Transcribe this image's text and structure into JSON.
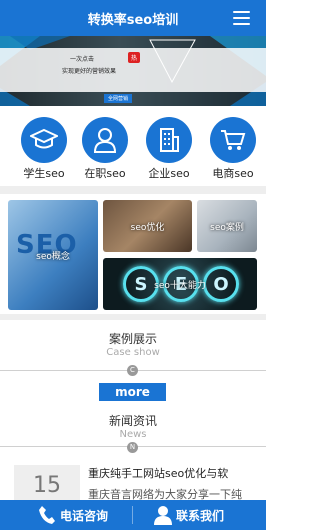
{
  "header": {
    "title": "转换率seo培训",
    "menu_icon": "hamburger-menu-icon"
  },
  "banner": {
    "line1": "一次点击",
    "hot_badge": "热",
    "line2": "实现更好的营销效果",
    "bottom_text": "全网营销"
  },
  "categories": [
    {
      "label": "学生seo",
      "icon": "graduation-cap-icon"
    },
    {
      "label": "在职seo",
      "icon": "user-icon"
    },
    {
      "label": "企业seo",
      "icon": "building-icon"
    },
    {
      "label": "电商seo",
      "icon": "cart-icon"
    }
  ],
  "tiles": [
    {
      "label": "seo概念",
      "art": "SEO"
    },
    {
      "label": "seo优化",
      "art": ""
    },
    {
      "label": "seo案例",
      "art": ""
    },
    {
      "label": "seo十大能力",
      "art": "SEO"
    }
  ],
  "cases": {
    "zh": "案例展示",
    "en": "Case show",
    "marker": "C"
  },
  "more": {
    "label": "more"
  },
  "news": {
    "zh": "新闻资讯",
    "en": "News",
    "marker": "N",
    "items": [
      {
        "day": "15",
        "title": "重庆纯手工网站seo优化与软",
        "desc": "重庆音言网络为大家分享一下纯"
      }
    ]
  },
  "footer": {
    "call_label": "电话咨询",
    "contact_label": "联系我们"
  },
  "colors": {
    "brand": "#1a74d3",
    "separator": "#eeeeee"
  }
}
